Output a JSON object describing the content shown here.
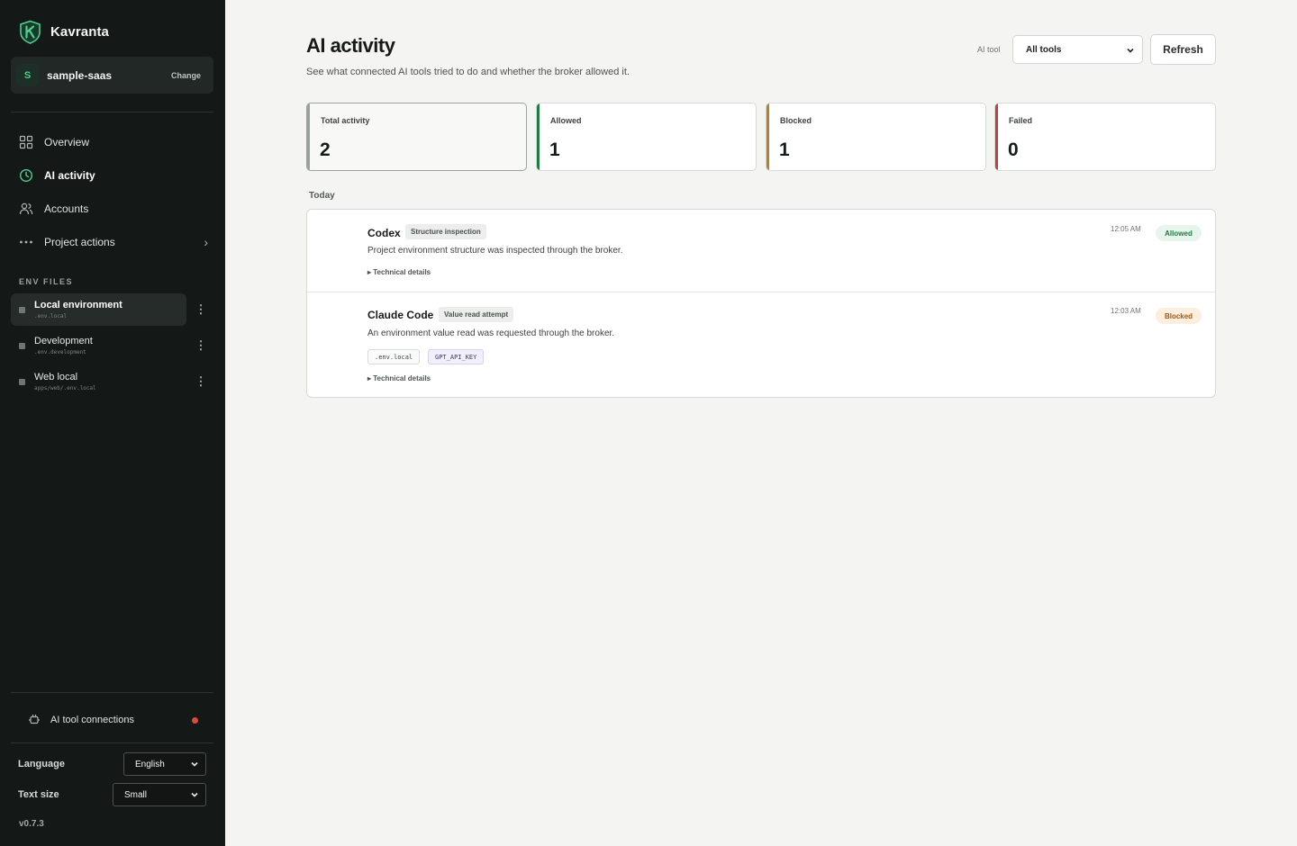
{
  "app": {
    "name": "Kavranta",
    "version": "v0.7.3"
  },
  "project": {
    "initial": "S",
    "name": "sample-saas",
    "change_label": "Change"
  },
  "nav": [
    {
      "label": "Overview",
      "icon": "grid-icon"
    },
    {
      "label": "AI activity",
      "icon": "clock-icon",
      "active": true
    },
    {
      "label": "Accounts",
      "icon": "users-icon"
    },
    {
      "label": "Project actions",
      "icon": "more-horizontal-icon"
    }
  ],
  "env_files": {
    "section_label": "ENV FILES",
    "items": [
      {
        "name": "Local environment",
        "file": ".env.local",
        "active": true
      },
      {
        "name": "Development",
        "file": ".env.development"
      },
      {
        "name": "Web local",
        "file": "apps/web/.env.local"
      }
    ]
  },
  "connections": {
    "label": "AI tool connections",
    "status_color": "#e0493f"
  },
  "settings": {
    "language_label": "Language",
    "language_value": "English",
    "text_size_label": "Text size",
    "text_size_value": "Small"
  },
  "header": {
    "title": "AI activity",
    "subtitle": "See what connected AI tools tried to do and whether the broker allowed it.",
    "tool_filter_label": "AI tool",
    "tool_filter_value": "All tools",
    "refresh_label": "Refresh"
  },
  "stats": [
    {
      "label": "Total activity",
      "value": "2",
      "color": "#9aa19d"
    },
    {
      "label": "Allowed",
      "value": "1",
      "color": "#1f7a45"
    },
    {
      "label": "Blocked",
      "value": "1",
      "color": "#c27a2c"
    },
    {
      "label": "Failed",
      "value": "0",
      "color": "#c0413a"
    }
  ],
  "feed": {
    "group_label": "Today",
    "entries": [
      {
        "tool": "Codex",
        "kind": "Structure inspection",
        "description": "Project environment structure was inspected through the broker.",
        "time": "12:05 AM",
        "status": "Allowed",
        "details_label": "Technical details"
      },
      {
        "tool": "Claude Code",
        "kind": "Value read attempt",
        "description": "An environment value read was requested through the broker.",
        "chips": [
          ".env.local",
          "GPT_API_KEY"
        ],
        "time": "12:03 AM",
        "status": "Blocked",
        "details_label": "Technical details"
      }
    ]
  },
  "colors": {
    "sidebar_bg": "#141816",
    "brand_accent": "#4fcf8d",
    "page_bg": "#f4f5f2"
  }
}
